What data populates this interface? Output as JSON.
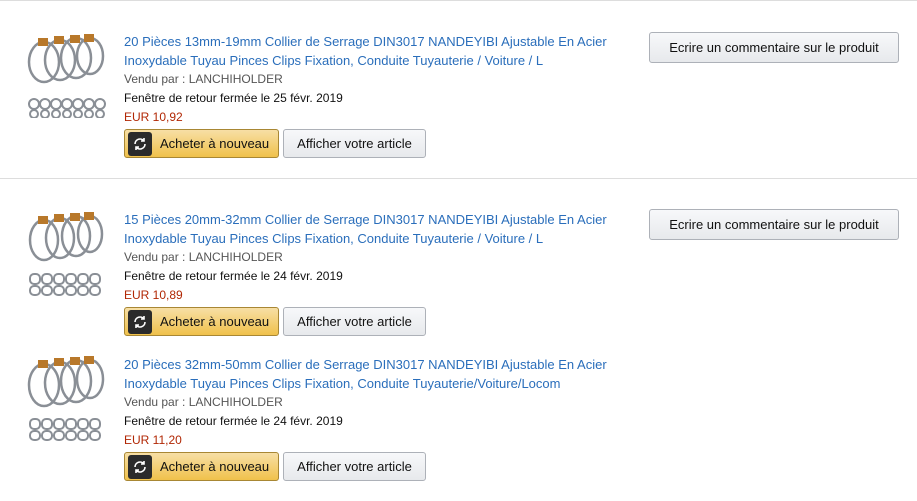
{
  "orders": [
    {
      "title_line1": "20 Pièces 13mm-19mm Collier de Serrage DIN3017 NANDEYIBI Ajustable En Acier",
      "title_line2": "Inoxydable Tuyau Pinces Clips Fixation, Conduite Tuyauterie / Voiture / L",
      "seller": "Vendu par : LANCHIHOLDER",
      "return_window": "Fenêtre de retour fermée le 25 févr. 2019",
      "price": "EUR 10,92",
      "buy_again_label": "Acheter à nouveau",
      "view_item_label": "Afficher votre article",
      "review_label": "Ecrire un commentaire sur le produit"
    },
    {
      "title_line1": "15 Pièces 20mm-32mm Collier de Serrage DIN3017 NANDEYIBI Ajustable En Acier",
      "title_line2": "Inoxydable Tuyau Pinces Clips Fixation, Conduite Tuyauterie / Voiture / L",
      "seller": "Vendu par : LANCHIHOLDER",
      "return_window": "Fenêtre de retour fermée le 24 févr. 2019",
      "price": "EUR 10,89",
      "buy_again_label": "Acheter à nouveau",
      "view_item_label": "Afficher votre article",
      "review_label": "Ecrire un commentaire sur le produit"
    },
    {
      "title_line1": "20 Pièces 32mm-50mm Collier de Serrage DIN3017 NANDEYIBI Ajustable En Acier",
      "title_line2": "Inoxydable Tuyau Pinces Clips Fixation, Conduite Tuyauterie/Voiture/Locom",
      "seller": "Vendu par : LANCHIHOLDER",
      "return_window": "Fenêtre de retour fermée le 24 févr. 2019",
      "price": "EUR 11,20",
      "buy_again_label": "Acheter à nouveau",
      "view_item_label": "Afficher votre article"
    }
  ],
  "colors": {
    "link": "#2a6ebb",
    "price": "#b12704",
    "buy_button": "#f0c14b"
  }
}
